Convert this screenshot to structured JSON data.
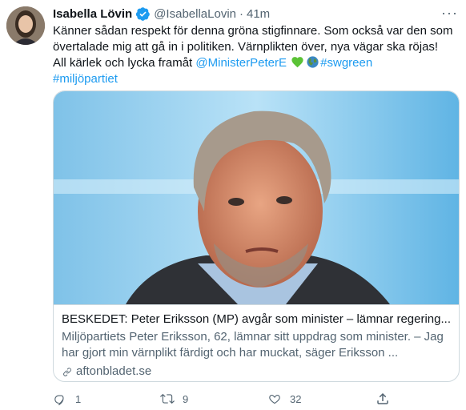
{
  "author": {
    "name": "Isabella Lövin",
    "handle": "@IsabellaLovin",
    "separator": "·",
    "time": "41m",
    "verified_icon": "verified-badge-icon"
  },
  "tweet": {
    "text_part1": "Känner sådan respekt för denna gröna stigfinnare. Som också var den som övertalade mig att gå in i politiken. Värnplikten över, nya vägar ska röjas! All kärlek och lycka framåt ",
    "mention": "@MinisterPeterE",
    "emojis": [
      "green-heart-icon",
      "globe-icon"
    ],
    "hashtag1": "#swgreen",
    "hashtag2": "#miljöpartiet"
  },
  "card": {
    "image_icon": "portrait-photo",
    "title": "BESKEDET: Peter Eriksson (MP) avgår som minister – lämnar regering...",
    "description": "Miljöpartiets Peter Eriksson, 62, lämnar sitt uppdrag som minister. – Jag har gjort min värnplikt färdigt och har muckat, säger Eriksson ...",
    "domain": "aftonbladet.se"
  },
  "actions": {
    "reply_count": "1",
    "retweet_count": "9",
    "like_count": "32"
  },
  "colors": {
    "link": "#1d9bf0",
    "secondary_text": "#536471",
    "border": "#cfd9de"
  }
}
